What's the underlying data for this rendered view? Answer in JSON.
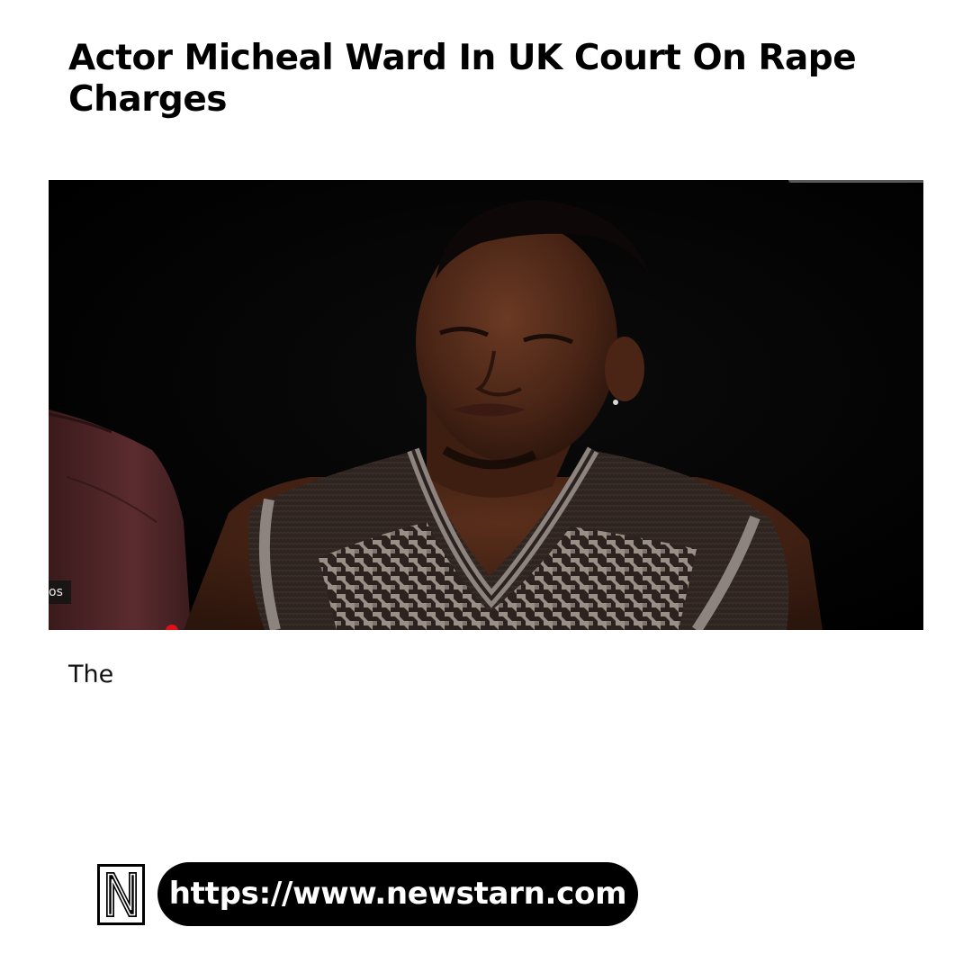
{
  "article": {
    "title": "Actor Micheal Ward In UK Court On Rape Charges",
    "hero_image": {
      "caption_fragment": "os"
    },
    "body_start": "The"
  },
  "footer": {
    "logo_letter": "N",
    "url": "https://www.newstarn.com"
  },
  "colors": {
    "background": "#ffffff",
    "text": "#000000",
    "pill_background": "#000000",
    "pill_text": "#ffffff",
    "live_dot": "#e0101a"
  }
}
